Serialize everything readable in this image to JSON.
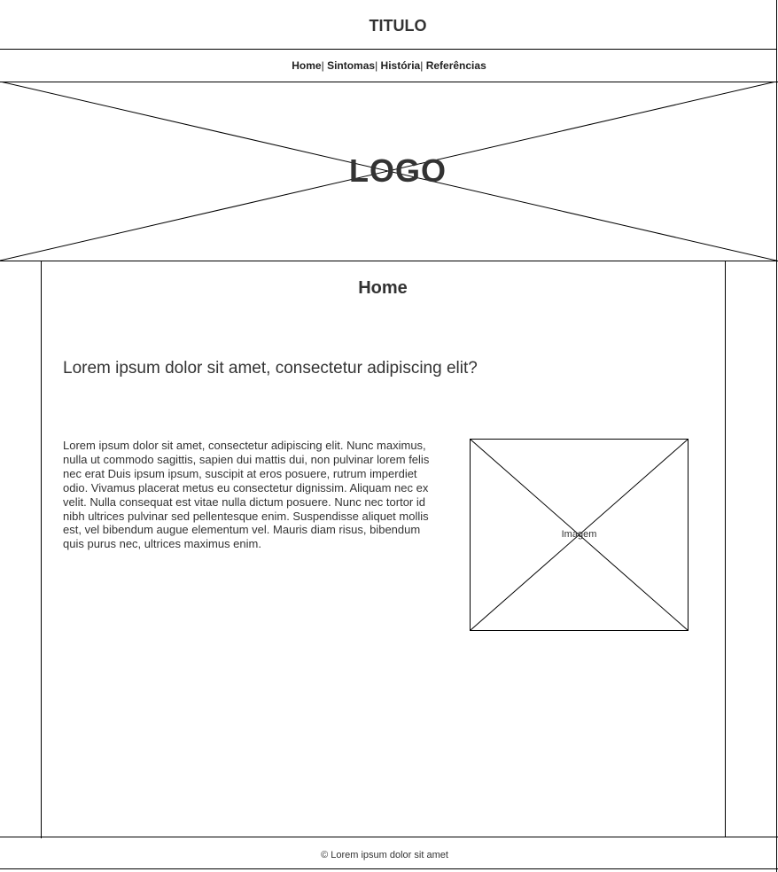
{
  "header": {
    "title": "TITULO"
  },
  "nav": {
    "items": [
      {
        "label": "Home"
      },
      {
        "label": "Sintomas"
      },
      {
        "label": "História"
      },
      {
        "label": "Referências"
      }
    ],
    "separator": "|"
  },
  "banner": {
    "logo_text": "LOGO"
  },
  "main": {
    "section_title": "Home",
    "question": "Lorem ipsum dolor sit amet, consectetur adipiscing elit?",
    "body": "Lorem ipsum dolor sit amet, consectetur adipiscing elit. Nunc maximus, nulla ut commodo sagittis, sapien dui mattis dui, non pulvinar lorem felis nec erat Duis ipsum ipsum, suscipit at eros posuere, rutrum imperdiet odio. Vivamus placerat metus eu consectetur dignissim. Aliquam nec ex velit. Nulla consequat est vitae nulla dictum posuere. Nunc nec tortor id nibh ultrices pulvinar sed pellentesque enim. Suspendisse aliquet mollis est, vel bibendum augue elementum vel. Mauris diam risus, bibendum quis purus nec, ultrices maximus enim.",
    "image_label": "Imagem"
  },
  "footer": {
    "text": "© Lorem ipsum dolor sit amet"
  },
  "colors": {
    "line": "#000000",
    "text": "#333333",
    "background": "#ffffff"
  }
}
